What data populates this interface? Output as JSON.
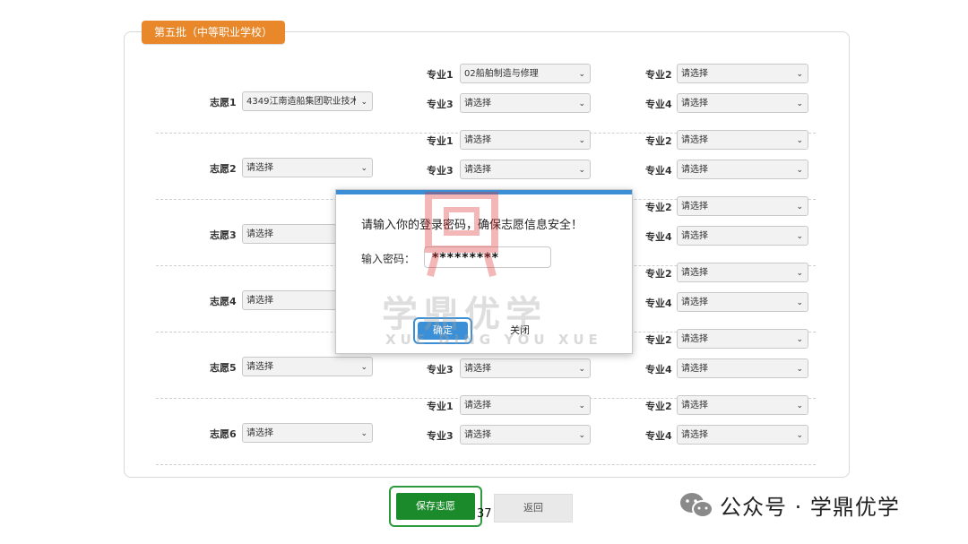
{
  "batch_tab": "第五批（中等职业学校）",
  "labels": {
    "major1": "专业1",
    "major2": "专业2",
    "major3": "专业3",
    "major4": "专业4"
  },
  "rows": [
    {
      "label": "志愿1",
      "school": "4349江南造船集团职业技术学",
      "major1": "02船舶制造与修理",
      "major2": "请选择",
      "major3": "请选择",
      "major4": "请选择"
    },
    {
      "label": "志愿2",
      "school": "请选择",
      "major1": "请选择",
      "major2": "请选择",
      "major3": "请选择",
      "major4": "请选择"
    },
    {
      "label": "志愿3",
      "school": "请选择",
      "major1": "",
      "major2": "请选择",
      "major3": "",
      "major4": "请选择"
    },
    {
      "label": "志愿4",
      "school": "请选择",
      "major1": "",
      "major2": "请选择",
      "major3": "",
      "major4": "请选择"
    },
    {
      "label": "志愿5",
      "school": "请选择",
      "major1": "",
      "major2": "请选择",
      "major3": "请选择",
      "major4": "请选择"
    },
    {
      "label": "志愿6",
      "school": "请选择",
      "major1": "请选择",
      "major2": "请选择",
      "major3": "请选择",
      "major4": "请选择"
    }
  ],
  "modal": {
    "title": "请输入你的登录密码，确保志愿信息安全！",
    "password_label": "输入密码：",
    "password_value": "*********",
    "ok": "确定",
    "close": "关闭"
  },
  "watermark": {
    "cn": "学鼎优学",
    "en": "XUE DING YOU XUE"
  },
  "buttons": {
    "save": "保存志愿",
    "back": "返回"
  },
  "page_number": "37",
  "footer_brand": "公众号 · 学鼎优学",
  "colors": {
    "tab": "#e8882a",
    "modal_accent": "#3a8fd6",
    "save": "#1a8a2a"
  }
}
